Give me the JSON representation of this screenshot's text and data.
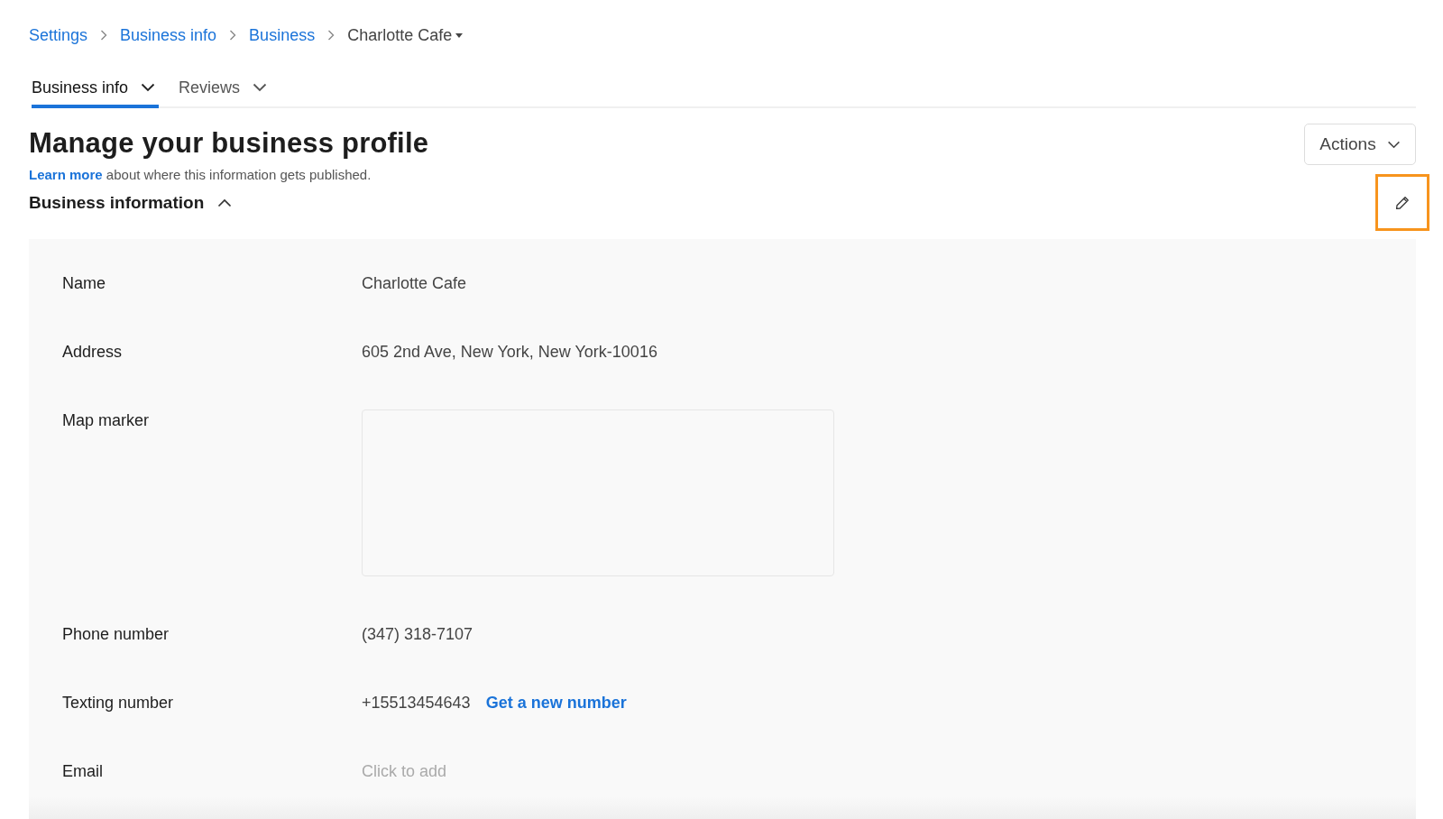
{
  "breadcrumb": [
    {
      "label": "Settings",
      "kind": "link"
    },
    {
      "label": "Business info",
      "kind": "link"
    },
    {
      "label": "Business",
      "kind": "link"
    },
    {
      "label": "Charlotte Cafe",
      "kind": "current"
    }
  ],
  "tabs": [
    {
      "label": "Business info",
      "selected": true
    },
    {
      "label": "Reviews",
      "selected": false
    }
  ],
  "header": {
    "title": "Manage your business profile",
    "learn_more_link": "Learn more",
    "learn_more_text": "about where this information gets published.",
    "actions_button": "Actions"
  },
  "edit_button": {
    "highlighted": true
  },
  "section": {
    "title": "Business information",
    "expanded": true,
    "rows": [
      {
        "label": "Name",
        "kind": "text",
        "value": "Charlotte Cafe"
      },
      {
        "label": "Address",
        "kind": "text",
        "value": "605 2nd Ave, New York, New York-10016"
      },
      {
        "label": "Map marker",
        "kind": "map"
      },
      {
        "label": "Phone number",
        "kind": "text",
        "value": "(347) 318-7107"
      },
      {
        "label": "Texting number",
        "kind": "text",
        "value": "+15513454643",
        "link": "Get a new number"
      },
      {
        "label": "Email",
        "kind": "empty",
        "placeholder": "Click to add"
      }
    ]
  }
}
